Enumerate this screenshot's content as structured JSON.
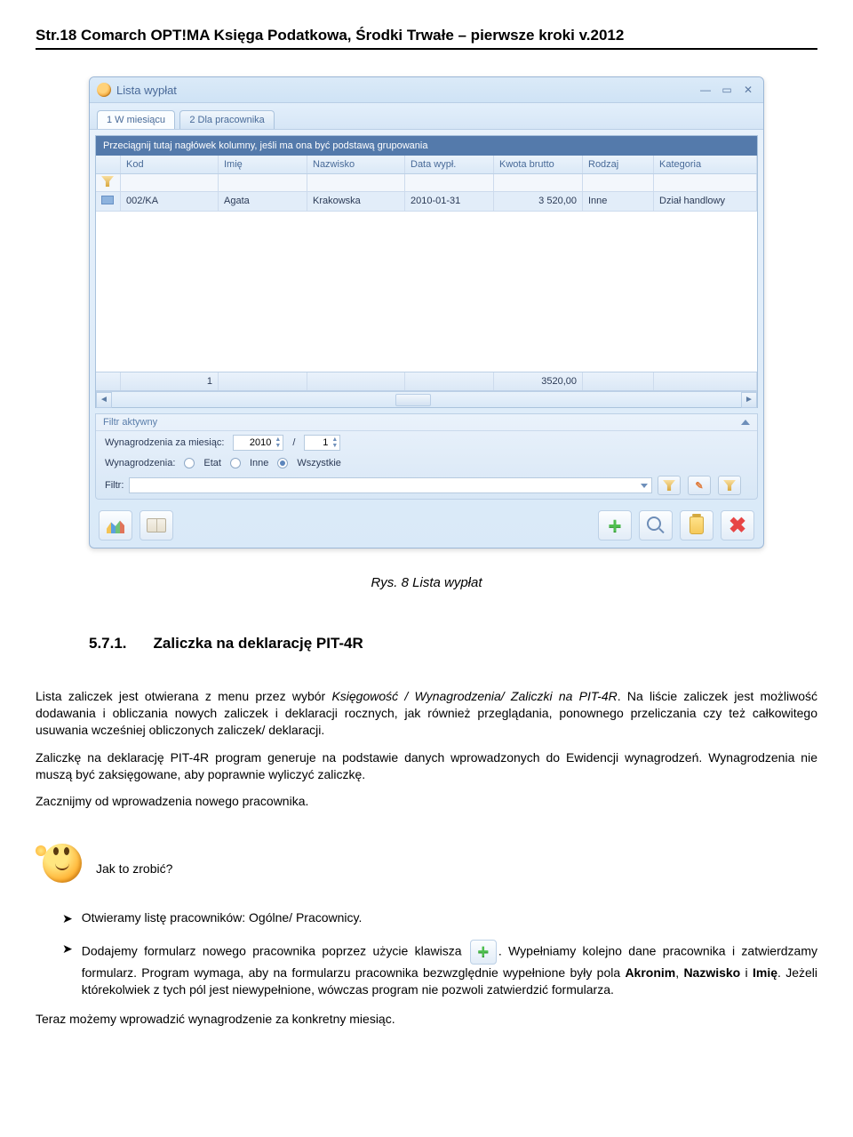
{
  "page_header": "Str.18 Comarch OPT!MA Księga Podatkowa, Środki Trwałe – pierwsze kroki v.2012",
  "window": {
    "title": "Lista wypłat",
    "tabs": [
      {
        "label": "1 W miesiącu",
        "active": true
      },
      {
        "label": "2 Dla pracownika",
        "active": false
      }
    ],
    "group_bar": "Przeciągnij tutaj nagłówek kolumny, jeśli ma ona być podstawą grupowania",
    "columns": [
      "",
      "Kod",
      "Imię",
      "Nazwisko",
      "Data wypł.",
      "Kwota brutto",
      "Rodzaj",
      "Kategoria"
    ],
    "rows": [
      {
        "kod": "002/KA",
        "imie": "Agata",
        "nazwisko": "Krakowska",
        "data": "2010-01-31",
        "kwota": "3 520,00",
        "rodzaj": "Inne",
        "kategoria": "Dział handlowy"
      }
    ],
    "summary": {
      "count": "1",
      "kwota": "3520,00"
    },
    "filter_panel": {
      "title": "Filtr aktywny",
      "label_month": "Wynagrodzenia za miesiąc:",
      "year": "2010",
      "sep": "/",
      "month": "1",
      "label_type": "Wynagrodzenia:",
      "radios": [
        {
          "label": "Etat",
          "selected": false
        },
        {
          "label": "Inne",
          "selected": false
        },
        {
          "label": "Wszystkie",
          "selected": true
        }
      ],
      "label_filter": "Filtr:"
    }
  },
  "doc": {
    "fig_caption": "Rys. 8 Lista wypłat",
    "section_num": "5.7.1.",
    "section_title": "Zaliczka na deklarację PIT-4R",
    "p1_a": "Lista zaliczek jest otwierana z menu przez wybór ",
    "p1_it": "Księgowość / Wynagrodzenia/ Zaliczki na PIT-4R",
    "p1_b": ". Na liście zaliczek jest możliwość dodawania i obliczania nowych zaliczek i deklaracji rocznych, jak również przeglądania, ponownego przeliczania czy też całkowitego usuwania wcześniej obliczonych zaliczek/ deklaracji.",
    "p2": "Zaliczkę na deklarację PIT-4R program generuje na podstawie danych wprowadzonych do Ewidencji wynagrodzeń. Wynagrodzenia nie muszą być zaksięgowane, aby poprawnie wyliczyć zaliczkę.",
    "p3": "Zacznijmy od wprowadzenia nowego pracownika.",
    "smiley_label": "Jak to zrobić?",
    "b1_a": "Otwieramy listę pracowników: ",
    "b1_it": "Ogólne/ Pracownicy",
    "b1_b": ".",
    "b2_a": "Dodajemy formularz nowego pracownika poprzez użycie klawisza ",
    "b2_b": ". Wypełniamy kolejno dane pracownika i zatwierdzamy formularz. Program wymaga, aby na formularzu pracownika bezwzględnie wypełnione były pola ",
    "b2_s1": "Akronim",
    "b2_c": ", ",
    "b2_s2": "Nazwisko",
    "b2_d": " i ",
    "b2_s3": "Imię",
    "b2_e": ". Jeżeli którekolwiek z tych pól jest niewypełnione, wówczas program nie pozwoli zatwierdzić formularza.",
    "p4": "Teraz możemy wprowadzić wynagrodzenie za konkretny miesiąc."
  }
}
